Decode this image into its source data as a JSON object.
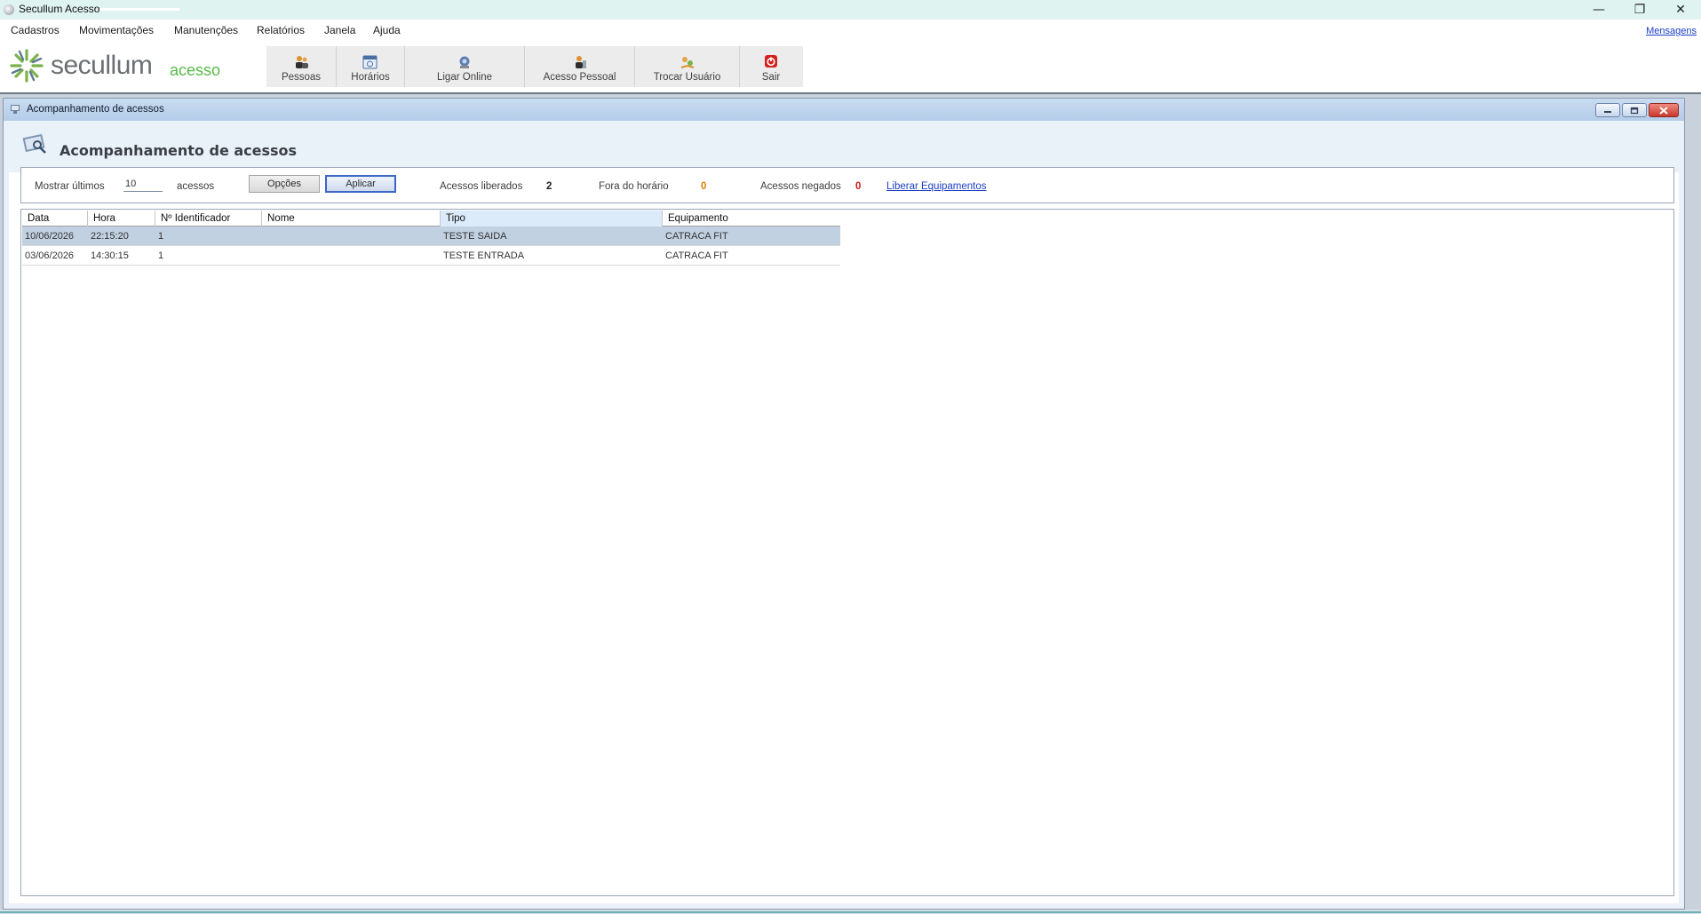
{
  "window": {
    "title": "Secullum Acesso",
    "controls": {
      "minimize": "—",
      "restore": "❐",
      "close": "✕"
    }
  },
  "menu": {
    "items": [
      "Cadastros",
      "Movimentações",
      "Manutenções",
      "Relatórios",
      "Janela",
      "Ajuda"
    ],
    "messages_link": "Mensagens"
  },
  "logo": {
    "main": "secullum",
    "sub": "acesso",
    "brand_green": "#57b947"
  },
  "toolbar": {
    "buttons": [
      {
        "label": "Pessoas",
        "icon": "people-icon"
      },
      {
        "label": "Horários",
        "icon": "schedule-icon"
      },
      {
        "label": "Ligar Online",
        "icon": "online-icon"
      },
      {
        "label": "Acesso Pessoal",
        "icon": "personal-access-icon"
      },
      {
        "label": "Trocar Usuário",
        "icon": "switch-user-icon"
      },
      {
        "label": "Sair",
        "icon": "power-icon"
      }
    ]
  },
  "child_window": {
    "title": "Acompanhamento de acessos",
    "heading": "Acompanhamento de acessos"
  },
  "filters": {
    "show_last_label": "Mostrar últimos",
    "show_last_value": "10",
    "accesses_suffix": "acessos",
    "options_button": "Opções",
    "apply_button": "Aplicar",
    "released_label": "Acessos liberados",
    "released_count": "2",
    "out_of_hours_label": "Fora do horário",
    "out_of_hours_count": "0",
    "denied_label": "Acessos negados",
    "denied_count": "0",
    "release_link": "Liberar Equipamentos",
    "colors": {
      "released": "#222222",
      "out_of_hours": "#e07b00",
      "denied": "#d01818"
    }
  },
  "grid": {
    "columns": [
      "Data",
      "Hora",
      "Nº Identificador",
      "Nome",
      "Tipo",
      "Equipamento"
    ],
    "sorted_column": "Tipo",
    "rows": [
      {
        "data": "10/06/2026",
        "hora": "22:15:20",
        "identificador": "1",
        "nome": "",
        "tipo": "TESTE SAIDA",
        "equipamento": "CATRACA FIT"
      },
      {
        "data": "03/06/2026",
        "hora": "14:30:15",
        "identificador": "1",
        "nome": "",
        "tipo": "TESTE ENTRADA",
        "equipamento": "CATRACA FIT"
      }
    ]
  }
}
